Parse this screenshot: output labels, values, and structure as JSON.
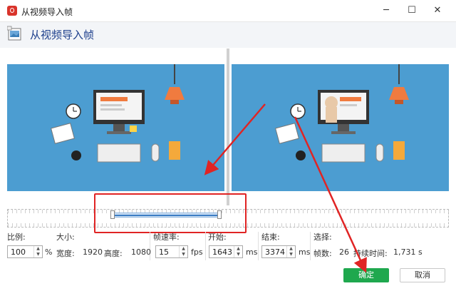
{
  "window": {
    "title": "从视频导入帧",
    "minimize_icon": "minimize-icon",
    "maximize_icon": "maximize-icon",
    "close_icon": "close-icon",
    "minimize_glyph": "─",
    "maximize_glyph": "☐",
    "close_glyph": "✕"
  },
  "header": {
    "title": "从视频导入帧",
    "icon": "film-frame-icon"
  },
  "controls": {
    "scale": {
      "label": "比例:",
      "value": "100",
      "unit": "%"
    },
    "size": {
      "label": "大小:",
      "width_label": "宽度:",
      "width": "1920",
      "height_label": "高度:",
      "height": "1080"
    },
    "framerate": {
      "label": "帧速率:",
      "value": "15",
      "unit": "fps"
    },
    "start": {
      "label": "开始:",
      "value": "1643",
      "unit": "ms"
    },
    "end": {
      "label": "结束:",
      "value": "3374",
      "unit": "ms"
    },
    "selection": {
      "label": "选择:",
      "frames_label": "帧数:",
      "frames": "26",
      "duration_label": "持续时间:",
      "duration": "1,731 s"
    }
  },
  "buttons": {
    "ok": "确定",
    "cancel": "取消"
  },
  "timeline": {
    "selection_start_ms": 1643,
    "selection_end_ms": 3374
  },
  "colors": {
    "accent": "#1fa84e",
    "title_blue": "#1d3f8c",
    "frame_bg": "#4c9dd1",
    "annotation_red": "#e02424"
  }
}
